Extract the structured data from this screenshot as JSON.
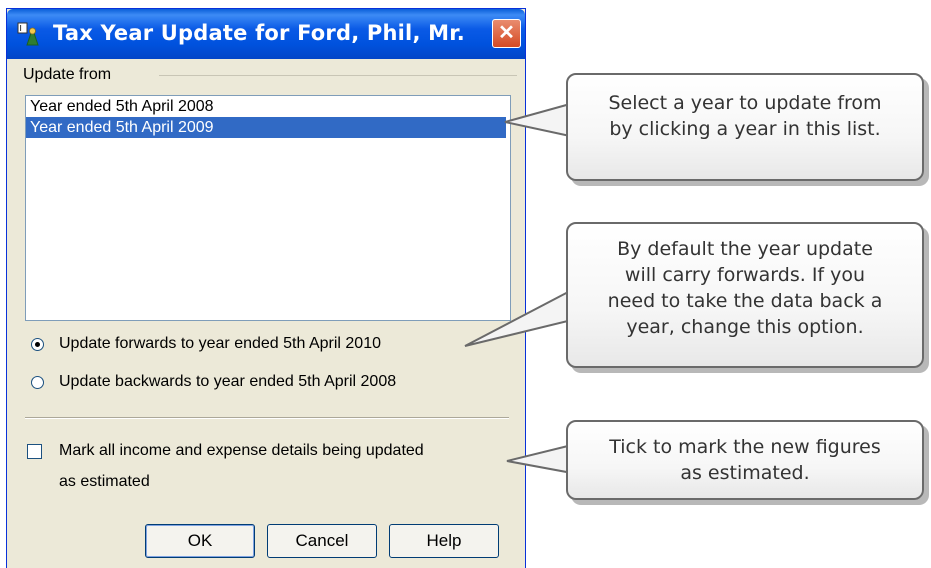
{
  "window": {
    "title": "Tax Year Update for Ford, Phil, Mr.",
    "close_glyph": "✕"
  },
  "update_from": {
    "label": "Update from",
    "years": [
      "Year ended 5th April 2008",
      "Year ended 5th April 2009"
    ],
    "selected_index": 1
  },
  "options": {
    "forwards": "Update forwards to year ended 5th April 2010",
    "backwards": "Update backwards to year ended 5th April 2008",
    "selected": "forwards"
  },
  "estimate_checkbox": {
    "line1": "Mark all income and expense details being updated",
    "line2": "as estimated",
    "checked": false
  },
  "buttons": {
    "ok": "OK",
    "cancel": "Cancel",
    "help": "Help"
  },
  "callouts": {
    "select_year": "Select a year to update from\nby clicking a year in this list.",
    "default_forward": "By default the year update\nwill carry forwards. If you\nneed to take the data back a\nyear, change this option.",
    "tick_estimate": "Tick to mark the new figures\nas estimated."
  },
  "icons": {
    "app": "app-icon",
    "close": "close-icon"
  },
  "colors": {
    "titlebar": "#0052de",
    "selection": "#316ac5",
    "dialog_bg": "#ece9d8"
  }
}
